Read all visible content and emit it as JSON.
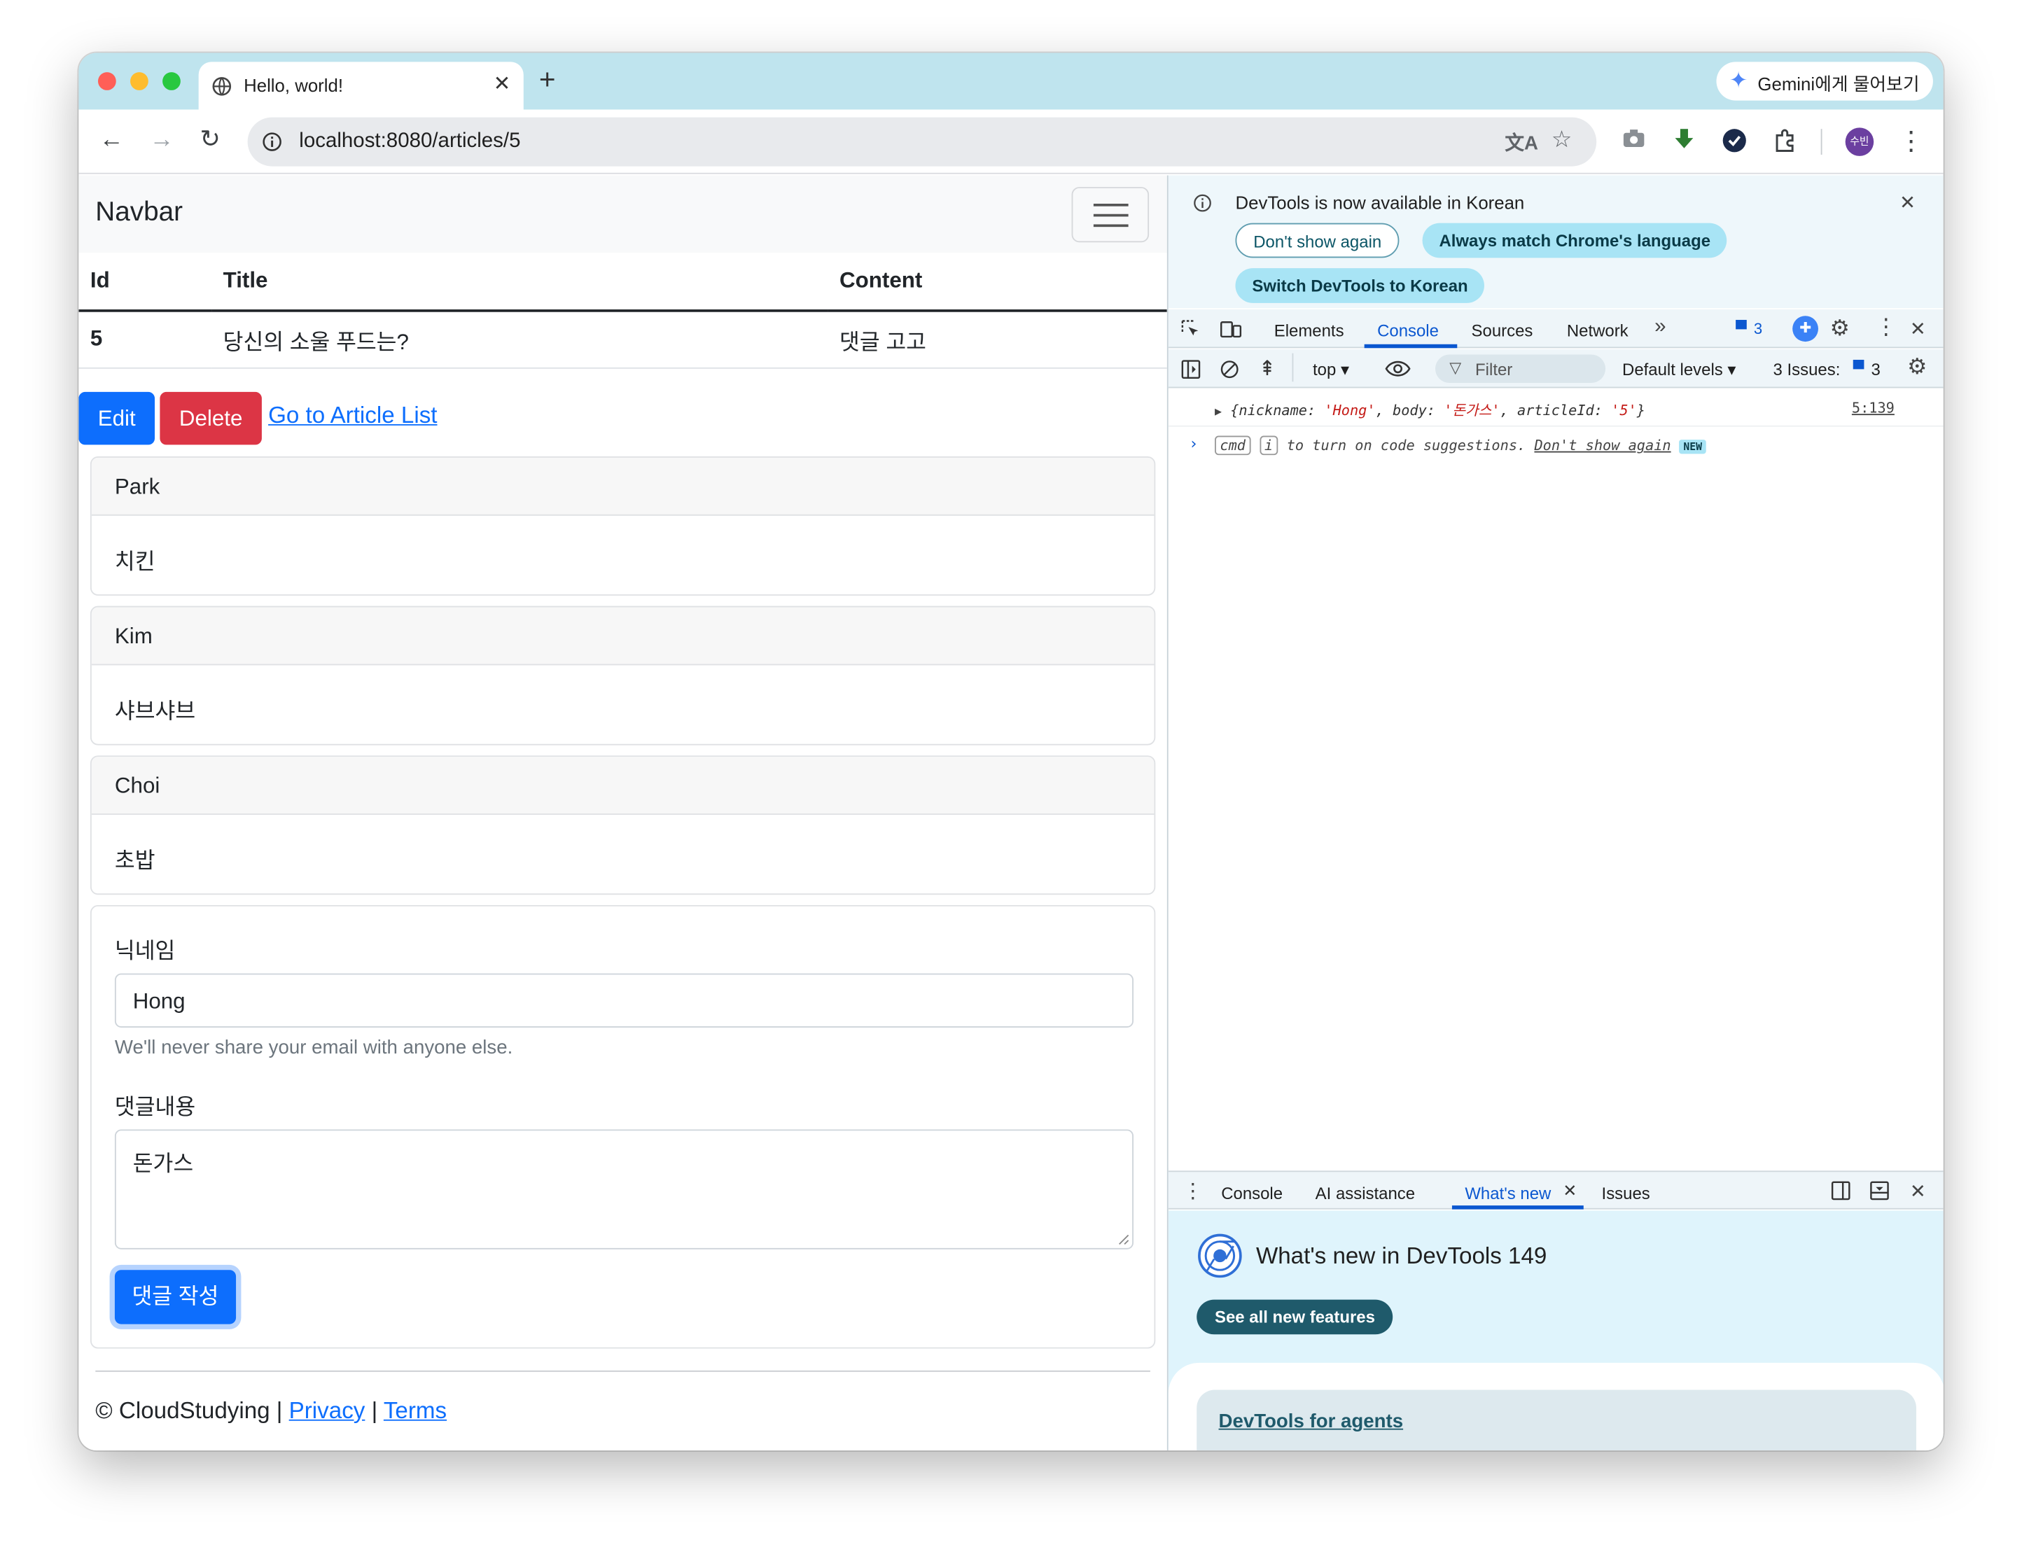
{
  "browser": {
    "tab_title": "Hello, world!",
    "gemini_label": "Gemini에게 물어보기",
    "url": "localhost:8080/articles/5",
    "profile_initials": "수빈"
  },
  "page": {
    "navbar_brand": "Navbar",
    "table": {
      "headers": [
        "Id",
        "Title",
        "Content"
      ],
      "row": {
        "id": "5",
        "title": "당신의 소울 푸드는?",
        "content": "댓글 고고"
      }
    },
    "actions": {
      "edit": "Edit",
      "delete": "Delete",
      "list_link": "Go to Article List"
    },
    "comments": [
      {
        "nickname": "Park",
        "body": "치킨"
      },
      {
        "nickname": "Kim",
        "body": "샤브샤브"
      },
      {
        "nickname": "Choi",
        "body": "초밥"
      }
    ],
    "form": {
      "nickname_label": "닉네임",
      "nickname_value": "Hong",
      "help_text": "We'll never share your email with anyone else.",
      "body_label": "댓글내용",
      "body_value": "돈가스",
      "submit": "댓글 작성"
    },
    "footer": {
      "copyright": "© CloudStudying |",
      "privacy": "Privacy",
      "separator": "|",
      "terms": "Terms"
    }
  },
  "devtools": {
    "infobar": {
      "message": "DevTools is now available in Korean",
      "dont_show": "Don't show again",
      "always_match": "Always match Chrome's language",
      "switch_korean": "Switch DevTools to Korean"
    },
    "tabs": [
      "Elements",
      "Console",
      "Sources",
      "Network"
    ],
    "active_tab": "Console",
    "message_count": "3",
    "toolbar": {
      "context": "top",
      "filter_placeholder": "Filter",
      "levels": "Default levels",
      "issues_label": "3 Issues:",
      "issues_count": "3"
    },
    "log": {
      "open": "{",
      "k1": "nickname",
      "v1": "'Hong'",
      "k2": "body",
      "v2": "'돈가스'",
      "k3": "articleId",
      "v3": "'5'",
      "close": "}",
      "source": "5:139"
    },
    "hint": {
      "cmd": "cmd",
      "key": "i",
      "text": "to turn on code suggestions.",
      "link": "Don't show again",
      "badge": "NEW"
    },
    "drawer_tabs": [
      "Console",
      "AI assistance",
      "What's new",
      "Issues"
    ],
    "drawer_active": "What's new",
    "whats_new": {
      "title": "What's new in DevTools 149",
      "button": "See all new features",
      "card_link": "DevTools for agents"
    }
  },
  "colors": {
    "tab_strip": "#bfe4ee",
    "primary": "#0d6efd",
    "danger": "#dc3545",
    "devtools_accent": "#0b57d0"
  },
  "icons": [
    "globe-icon",
    "back-icon",
    "forward-icon",
    "reload-icon",
    "info-icon",
    "translate-icon",
    "star-icon",
    "camera-icon",
    "download-icon",
    "check-icon",
    "extensions-icon",
    "more-icon",
    "close-icon",
    "inspect-icon",
    "device-icon",
    "gear-icon",
    "sidebar-icon",
    "clear-icon",
    "eye-icon",
    "filter-icon",
    "chrome-icon"
  ]
}
